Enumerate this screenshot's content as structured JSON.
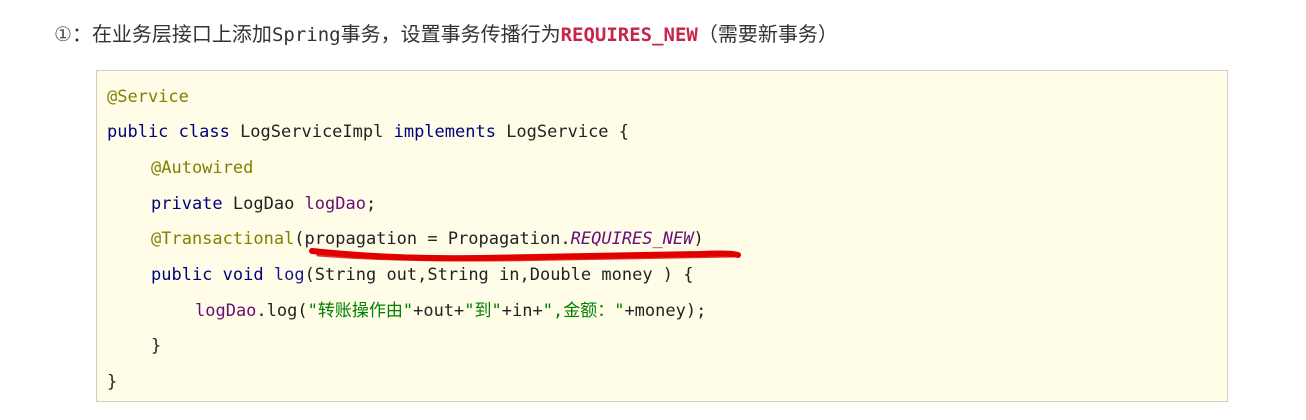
{
  "heading": {
    "circled": "①",
    "sep": "：",
    "pre": "在业务层接口上添加",
    "spring": "Spring",
    "mid": "事务，设置事务传播行为",
    "highlight": "REQUIRES_NEW",
    "post": "（需要新事务）"
  },
  "code": {
    "l1_annot": "@Service",
    "l2_kw1": "public class",
    "l2_name": " LogServiceImpl ",
    "l2_kw2": "implements",
    "l2_rest": " LogService {",
    "l3_annot": "@Autowired",
    "l4_kw": "private",
    "l4_type": " LogDao ",
    "l4_field": "logDao",
    "l4_end": ";",
    "l5_annot": "@Transactional",
    "l5_open": "(propagation = Propagation.",
    "l5_const": "REQUIRES_NEW",
    "l5_close": ")",
    "l6_kw": "public void",
    "l6_rest_pre": " ",
    "l6_method": "log",
    "l6_rest": "(String out,String in,Double money ) {",
    "l7_field": "logDao",
    "l7_dot": ".log(",
    "l7_str1": "\"转账操作由\"",
    "l7_op1": "+out+",
    "l7_str2": "\"到\"",
    "l7_op2": "+in+",
    "l7_str3": "\",金额：\"",
    "l7_end": "+money);",
    "l8": "}",
    "l9": "}"
  },
  "colors": {
    "highlight": "#c7254e",
    "code_bg": "#fffde8",
    "red_mark": "#e00000"
  }
}
